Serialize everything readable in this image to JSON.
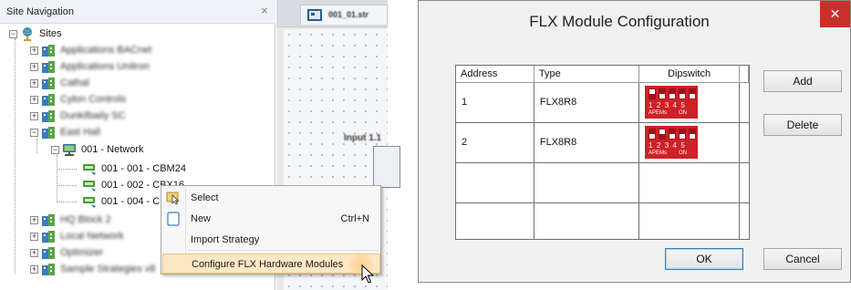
{
  "site_navigation": {
    "title": "Site Navigation",
    "close_glyph": "×",
    "root_label": "Sites",
    "expand_glyph": "+",
    "collapse_glyph": "−",
    "items": [
      {
        "label": "Applications BACnet",
        "blurred": true
      },
      {
        "label": "Applications Unitron",
        "blurred": true
      },
      {
        "label": "Cathal",
        "blurred": true
      },
      {
        "label": "Cylon Controls",
        "blurred": true
      },
      {
        "label": "Dunkilbaily SC",
        "blurred": true
      },
      {
        "label": "East Hall",
        "blurred": true
      },
      {
        "label": "001 - Network",
        "blurred": false
      },
      {
        "label": "001 - 001 - CBM24",
        "blurred": false
      },
      {
        "label": "001 - 002 - CBX16",
        "blurred": false
      },
      {
        "label": "001 - 004 - C",
        "blurred": false
      },
      {
        "label": "HQ Block 2",
        "blurred": true
      },
      {
        "label": "Local Network",
        "blurred": true
      },
      {
        "label": "Optimizer",
        "blurred": true
      },
      {
        "label": "Sample Strategies v8",
        "blurred": true
      }
    ]
  },
  "strategy_canvas": {
    "tab_label": "001_01.str",
    "block_label": "Input 1.1"
  },
  "context_menu": {
    "items": [
      {
        "label": "Select",
        "shortcut": "",
        "icon": "select-icon"
      },
      {
        "label": "New",
        "shortcut": "Ctrl+N",
        "icon": "new-document-icon"
      },
      {
        "label": "Import Strategy",
        "shortcut": "",
        "icon": ""
      },
      {
        "label": "Configure FLX Hardware Modules",
        "shortcut": "",
        "icon": "",
        "highlighted": true
      }
    ]
  },
  "flx_dialog": {
    "title": "FLX Module Configuration",
    "close_glyph": "✕",
    "columns": [
      "Address",
      "Type",
      "Dipswitch",
      ""
    ],
    "rows": [
      {
        "address": "1",
        "type": "FLX8R8",
        "dip_positions": [
          "up",
          "down",
          "down",
          "down",
          "down"
        ]
      },
      {
        "address": "2",
        "type": "FLX8R8",
        "dip_positions": [
          "down",
          "up",
          "down",
          "down",
          "down"
        ]
      },
      {
        "address": "",
        "type": "",
        "dip_positions": []
      },
      {
        "address": "",
        "type": "",
        "dip_positions": []
      }
    ],
    "dip_numbers": "12345",
    "dip_caption_left": "APEMs",
    "dip_caption_right": "ON",
    "buttons": {
      "add": "Add",
      "delete": "Delete",
      "ok": "OK",
      "cancel": "Cancel"
    }
  },
  "colors": {
    "dipswitch_red": "#cf2027",
    "dialog_close_red": "#c9302c",
    "menu_highlight": "#fde8c4",
    "default_button_border": "#3c7fb1"
  }
}
